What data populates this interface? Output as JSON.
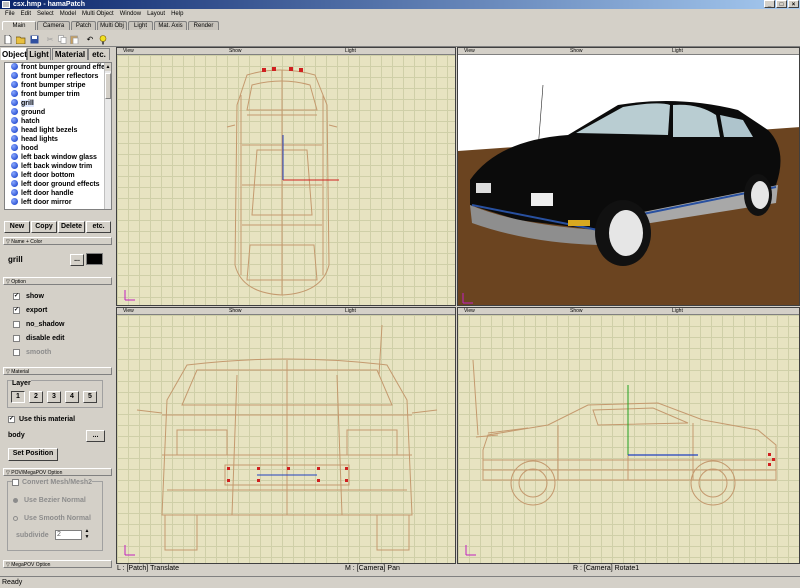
{
  "window": {
    "title": "csx.hmp - hamaPatch",
    "controls": [
      "_",
      "□",
      "×"
    ]
  },
  "menu": [
    "File",
    "Edit",
    "Select",
    "Model",
    "Multi Object",
    "Window",
    "Layout",
    "Help"
  ],
  "mode_tabs": [
    "Main",
    "Camera",
    "Patch",
    "Multi Obj",
    "Light",
    "Mat. Axis",
    "Render"
  ],
  "panel_tabs": [
    "Object",
    "Light",
    "Material",
    "etc."
  ],
  "objects": [
    "front bumper ground effe...",
    "front bumper reflectors",
    "front bumper stripe",
    "front bumper trim",
    "grill",
    "ground",
    "hatch",
    "head light bezels",
    "head lights",
    "hood",
    "left back window glass",
    "left back window trim",
    "left door bottom",
    "left door ground effects",
    "left door handle",
    "left door mirror"
  ],
  "selected_object": "grill",
  "list_buttons": {
    "new": "New",
    "copy": "Copy",
    "delete": "Delete",
    "etc": "etc."
  },
  "name_color": {
    "header": "Name + Color",
    "name": "grill",
    "color": "#000000",
    "picker": "..."
  },
  "option": {
    "header": "Option",
    "show": "show",
    "export": "export",
    "no_shadow": "no_shadow",
    "disable_edit": "disable edit",
    "smooth": "smooth"
  },
  "material": {
    "header": "Material",
    "layer_label": "Layer",
    "layers": [
      "1",
      "2",
      "3",
      "4",
      "5"
    ],
    "use_material": "Use this material",
    "material_name": "body",
    "browse": "...",
    "set_position": "Set Position"
  },
  "pov": {
    "header": "POV/MegaPOV Option",
    "convert": "Convert Mesh/Mesh2",
    "bezier": "Use Bezier Normal",
    "smooth_normal": "Use Smooth Normal",
    "subdivide_label": "subdivide",
    "subdivide_value": "2",
    "megapov_header": "MegaPOV Option"
  },
  "viewport_header": {
    "view": "View",
    "show": "Show",
    "light": "Light"
  },
  "mouse_status": {
    "left": "L : [Patch] Translate",
    "middle": "M : [Camera] Pan",
    "right": "R : [Camera] Rotate1"
  },
  "status": "Ready",
  "colors": {
    "accent": "#0a246a",
    "grid_bg": "#e7e3c1",
    "wire": "#c4996e",
    "ground": "#6b4420",
    "car_body": "#0b0b0b"
  }
}
